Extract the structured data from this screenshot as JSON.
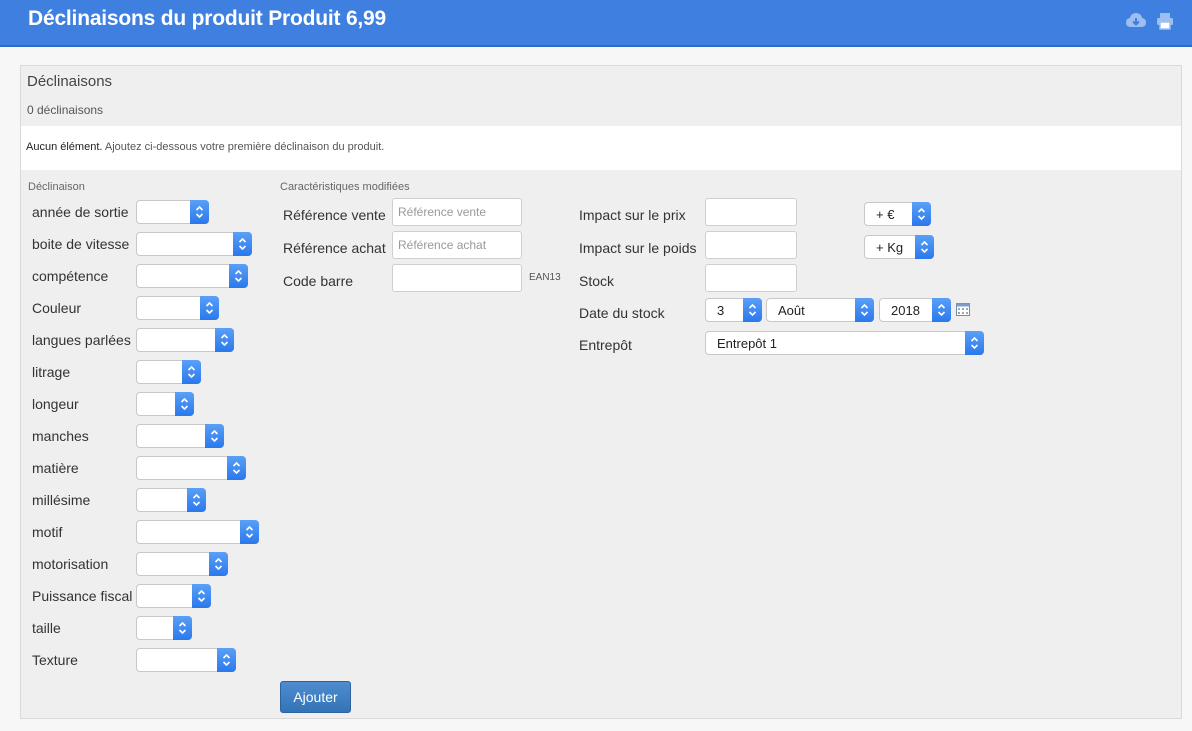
{
  "header": {
    "title": "Déclinaisons du produit Produit 6,99",
    "download_icon": "cloud-download-icon",
    "print_icon": "printer-icon"
  },
  "panel": {
    "title": "Déclinaisons",
    "count": "0 déclinaisons",
    "notice_strong": "Aucun élément.",
    "notice_text": " Ajoutez ci-dessous votre première déclinaison du produit."
  },
  "attributes": {
    "section_title": "Déclinaison",
    "items": [
      {
        "label": "année de sortie",
        "value": ""
      },
      {
        "label": "boite de vitesse",
        "value": ""
      },
      {
        "label": "compétence",
        "value": ""
      },
      {
        "label": "Couleur",
        "value": ""
      },
      {
        "label": "langues parlées",
        "value": ""
      },
      {
        "label": "litrage",
        "value": ""
      },
      {
        "label": "longeur",
        "value": ""
      },
      {
        "label": "manches",
        "value": ""
      },
      {
        "label": "matière",
        "value": ""
      },
      {
        "label": "millésime",
        "value": ""
      },
      {
        "label": "motif",
        "value": ""
      },
      {
        "label": "motorisation",
        "value": ""
      },
      {
        "label": "Puissance fiscal",
        "value": ""
      },
      {
        "label": "taille",
        "value": ""
      },
      {
        "label": "Texture",
        "value": ""
      }
    ]
  },
  "features": {
    "section_title": "Caractéristiques modifiées",
    "ref_sale_label": "Référence vente",
    "ref_sale_placeholder": "Référence vente",
    "ref_sale_value": "",
    "ref_purchase_label": "Référence achat",
    "ref_purchase_placeholder": "Référence achat",
    "ref_purchase_value": "",
    "barcode_label": "Code barre",
    "barcode_value": "",
    "barcode_hint": "EAN13"
  },
  "impacts": {
    "price_label": "Impact sur le prix",
    "price_value": "",
    "price_op": "+ €",
    "weight_label": "Impact sur le poids",
    "weight_value": "",
    "weight_op": "+ Kg",
    "stock_label": "Stock",
    "stock_value": "",
    "date_label": "Date du stock",
    "date_day": "3",
    "date_month": "Août",
    "date_year": "2018",
    "calendar_icon": "calendar-icon",
    "warehouse_label": "Entrepôt",
    "warehouse_value": "Entrepôt 1"
  },
  "actions": {
    "add_label": "Ajouter"
  },
  "colors": {
    "header": "#3f7fe0",
    "select_arrow": "#2a78ec",
    "button": "#3374b6"
  }
}
